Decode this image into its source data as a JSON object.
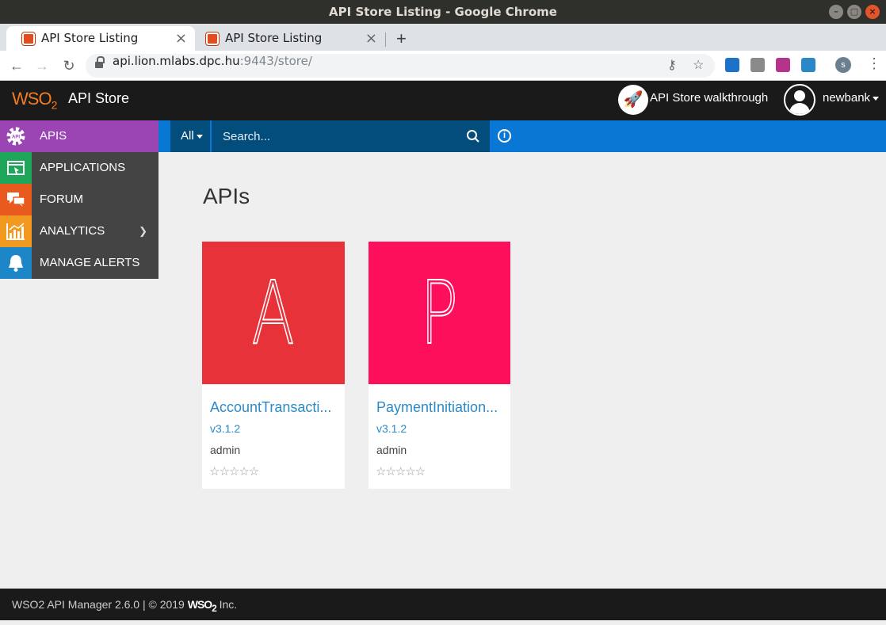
{
  "window": {
    "title": "API Store Listing - Google Chrome"
  },
  "tabs": [
    {
      "label": "API Store Listing",
      "active": true
    },
    {
      "label": "API Store Listing",
      "active": false
    }
  ],
  "address_bar": {
    "host": "api.lion.mlabs.dpc.hu",
    "rest": ":9443/store/"
  },
  "profile_initial": "s",
  "header": {
    "logo": "WSO",
    "logo_sub": "2",
    "app_title": "API Store",
    "walkthrough_label": "API Store walkthrough",
    "user_label": "newbank"
  },
  "search": {
    "filter_label": "All",
    "placeholder": "Search..."
  },
  "sidebar": {
    "items": [
      {
        "label": "APIS",
        "color": "#9b45b5",
        "icon": "api-gear-icon"
      },
      {
        "label": "APPLICATIONS",
        "color": "#1ea65a",
        "icon": "applications-icon"
      },
      {
        "label": "FORUM",
        "color": "#e95a1f",
        "icon": "forum-icon"
      },
      {
        "label": "ANALYTICS",
        "color": "#f29a1f",
        "icon": "analytics-icon"
      },
      {
        "label": "MANAGE ALERTS",
        "color": "#1d86c8",
        "icon": "bell-icon"
      }
    ]
  },
  "main": {
    "title": "APIs",
    "apis": [
      {
        "letter": "A",
        "name": "AccountTransacti...",
        "version": "v3.1.2",
        "provider": "admin",
        "rating": 0,
        "color": "#e8323a"
      },
      {
        "letter": "P",
        "name": "PaymentInitiation...",
        "version": "v3.1.2",
        "provider": "admin",
        "rating": 0,
        "color": "#fe0f5b"
      }
    ]
  },
  "footer": {
    "text": "WSO2 API Manager 2.6.0 | © 2019 ",
    "brand": "WSO",
    "brand_sub": "2",
    "suffix": " Inc."
  }
}
